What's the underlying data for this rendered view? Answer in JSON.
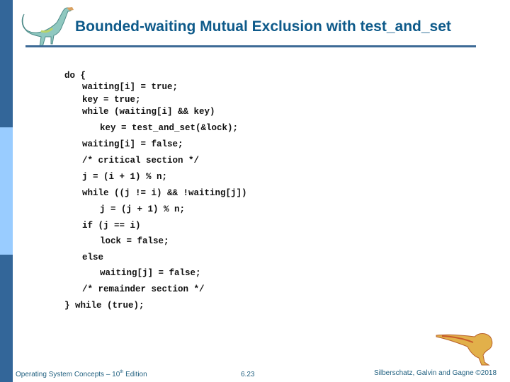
{
  "slide": {
    "title": "Bounded-waiting Mutual Exclusion with test_and_set",
    "colors": {
      "title": "#0e5a8a",
      "sidebar_dark": "#336699",
      "sidebar_light": "#99ccff",
      "rule": "#3d6a96",
      "footer_text": "#1f5f7f"
    },
    "code_lines": [
      {
        "indent": 0,
        "text": "do {"
      },
      {
        "indent": 1,
        "text": "waiting[i] = true;"
      },
      {
        "indent": 1,
        "text": "key = true;"
      },
      {
        "indent": 1,
        "text": "while (waiting[i] && key)"
      },
      {
        "indent": 2,
        "text": "key = test_and_set(&lock);"
      },
      {
        "indent": 1,
        "text": "waiting[i] = false;"
      },
      {
        "indent": 1,
        "text": "/* critical section */"
      },
      {
        "indent": 1,
        "text": "j = (i + 1) % n;"
      },
      {
        "indent": 1,
        "text": "while ((j != i) && !waiting[j])"
      },
      {
        "indent": 2,
        "text": "j = (j + 1) % n;"
      },
      {
        "indent": 1,
        "text": "if (j == i)"
      },
      {
        "indent": 2,
        "text": "lock = false;"
      },
      {
        "indent": 1,
        "text": "else"
      },
      {
        "indent": 2,
        "text": "waiting[j] = false;"
      },
      {
        "indent": 1,
        "text": "/* remainder section */"
      },
      {
        "indent": 0,
        "text": "} while (true);"
      }
    ]
  },
  "footer": {
    "book_prefix": "Operating System Concepts – 10",
    "book_sup": "th",
    "book_suffix": " Edition",
    "page_number": "6.23",
    "copyright": "Silberschatz, Galvin and Gagne ©2018"
  },
  "icons": {
    "top_logo": "dinosaur-logo-icon",
    "bottom_logo": "dinosaur-logo-icon"
  }
}
